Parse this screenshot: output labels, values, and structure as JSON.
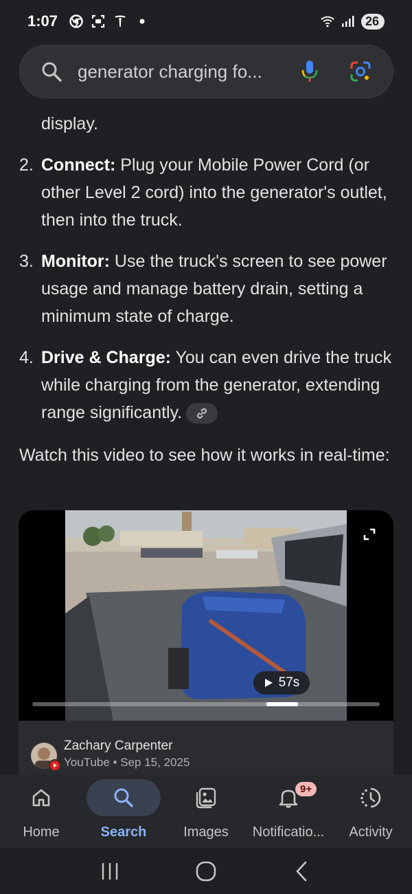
{
  "status_bar": {
    "time": "1:07",
    "icons_left": [
      "chrome-icon",
      "screenshot-icon",
      "tesla-icon",
      "dot-icon"
    ],
    "icons_right": [
      "wifi-icon",
      "signal-icon"
    ],
    "battery": "26"
  },
  "search": {
    "query": "generator charging fo...",
    "icon": "search-icon",
    "mic_icon": "mic-icon",
    "lens_icon": "lens-icon"
  },
  "content": {
    "fragment_end": "display.",
    "steps": [
      {
        "number": "2.",
        "title": "Connect:",
        "text": " Plug your Mobile Power Cord (or other Level 2 cord) into the generator's outlet, then into the truck."
      },
      {
        "number": "3.",
        "title": "Monitor:",
        "text": " Use the truck's screen to see power usage and manage battery drain, setting a minimum state of charge."
      },
      {
        "number": "4.",
        "title": "Drive & Charge:",
        "text": " You can even drive the truck while charging from the generator, extending range significantly."
      }
    ],
    "watch_text": "Watch this video to see how it works in real-time:"
  },
  "video": {
    "duration": "57s",
    "progress_position": 0.72,
    "channel_name": "Zachary Carpenter",
    "source": "YouTube",
    "date": "Sep 15, 2025",
    "meta_separator": " • "
  },
  "bottom_nav": {
    "items": [
      {
        "label": "Home",
        "icon": "home-icon"
      },
      {
        "label": "Search",
        "icon": "search-icon"
      },
      {
        "label": "Images",
        "icon": "images-icon"
      },
      {
        "label": "Notificatio...",
        "icon": "bell-icon",
        "badge": "9+"
      },
      {
        "label": "Activity",
        "icon": "activity-icon"
      }
    ],
    "active": "Search"
  },
  "colors": {
    "background": "#1f2023",
    "accent": "#8ab4f8",
    "badge": "#f2b8b5"
  }
}
